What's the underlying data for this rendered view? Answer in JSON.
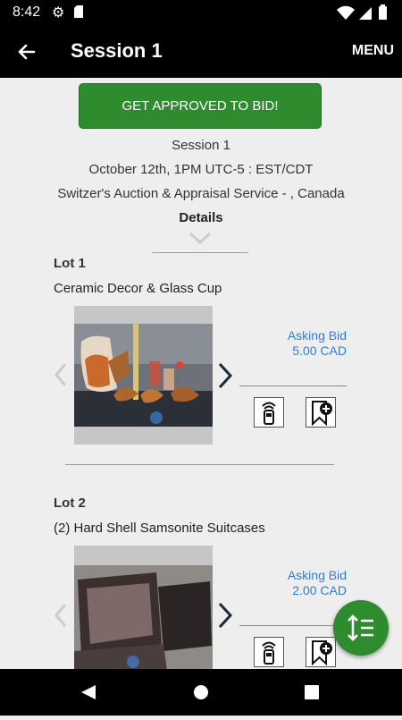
{
  "status_bar": {
    "time": "8:42"
  },
  "app_bar": {
    "title": "Session 1",
    "menu_label": "MENU"
  },
  "approve_button": "GET APPROVED TO BID!",
  "session": {
    "name": "Session 1",
    "date": "October 12th, 1PM UTC-5 : EST/CDT",
    "auctioneer": "Switzer's Auction & Appraisal Service - , Canada",
    "details_label": "Details"
  },
  "lots": [
    {
      "title": "Lot 1",
      "description": "Ceramic Decor & Glass Cup",
      "asking_label": "Asking Bid",
      "asking_value": "5.00 CAD"
    },
    {
      "title": "Lot 2",
      "description": "(2) Hard Shell Samsonite Suitcases",
      "asking_label": "Asking Bid",
      "asking_value": "2.00 CAD"
    }
  ],
  "colors": {
    "accent_green": "#2e8b2e",
    "link_blue": "#2f7fd8",
    "bar_black": "#000000",
    "background": "#eeeeee"
  },
  "icons": {
    "back": "arrow-left-icon",
    "remote_bid": "remote-icon",
    "watch": "bookmark-add-icon",
    "fab": "sort-icon"
  }
}
